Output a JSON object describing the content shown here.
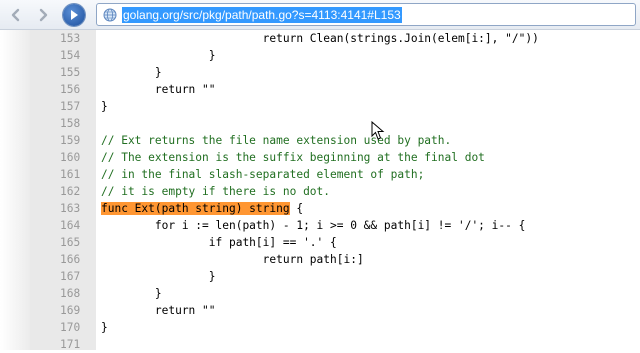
{
  "browser": {
    "back_icon": "back-arrow-icon",
    "forward_icon": "forward-arrow-icon",
    "go_icon": "go-circle-icon",
    "site_icon": "globe-icon",
    "url": "golang.org/src/pkg/path/path.go?s=4113:4141#L153",
    "url_selected": true,
    "accent_color": "#3399ff"
  },
  "code": {
    "lines": [
      {
        "num": "153",
        "text": "                        return Clean(strings.Join(elem[i:], \"/\"))",
        "style": "code"
      },
      {
        "num": "154",
        "text": "                }",
        "style": "code"
      },
      {
        "num": "155",
        "text": "        }",
        "style": "code"
      },
      {
        "num": "156",
        "text": "        return \"\"",
        "style": "code"
      },
      {
        "num": "157",
        "text": "}",
        "style": "code"
      },
      {
        "num": "158",
        "text": "",
        "style": "code"
      },
      {
        "num": "159",
        "text": "// Ext returns the file name extension used by path.",
        "style": "comment"
      },
      {
        "num": "160",
        "text": "// The extension is the suffix beginning at the final dot",
        "style": "comment"
      },
      {
        "num": "161",
        "text": "// in the final slash-separated element of path;",
        "style": "comment"
      },
      {
        "num": "162",
        "text": "// it is empty if there is no dot.",
        "style": "comment"
      },
      {
        "num": "163",
        "text": " {",
        "highlight": "func Ext(path string) string",
        "style": "code"
      },
      {
        "num": "164",
        "text": "        for i := len(path) - 1; i >= 0 && path[i] != '/'; i-- {",
        "style": "code"
      },
      {
        "num": "165",
        "text": "                if path[i] == '.' {",
        "style": "code"
      },
      {
        "num": "166",
        "text": "                        return path[i:]",
        "style": "code"
      },
      {
        "num": "167",
        "text": "                }",
        "style": "code"
      },
      {
        "num": "168",
        "text": "        }",
        "style": "code"
      },
      {
        "num": "169",
        "text": "        return \"\"",
        "style": "code"
      },
      {
        "num": "170",
        "text": "}",
        "style": "code"
      },
      {
        "num": "171",
        "text": "",
        "style": "code"
      }
    ],
    "comment_color": "#216f21",
    "highlight_color": "#ff9632",
    "gutter_color": "#e9e9e9"
  },
  "cursor_icon": "mouse-pointer-icon"
}
